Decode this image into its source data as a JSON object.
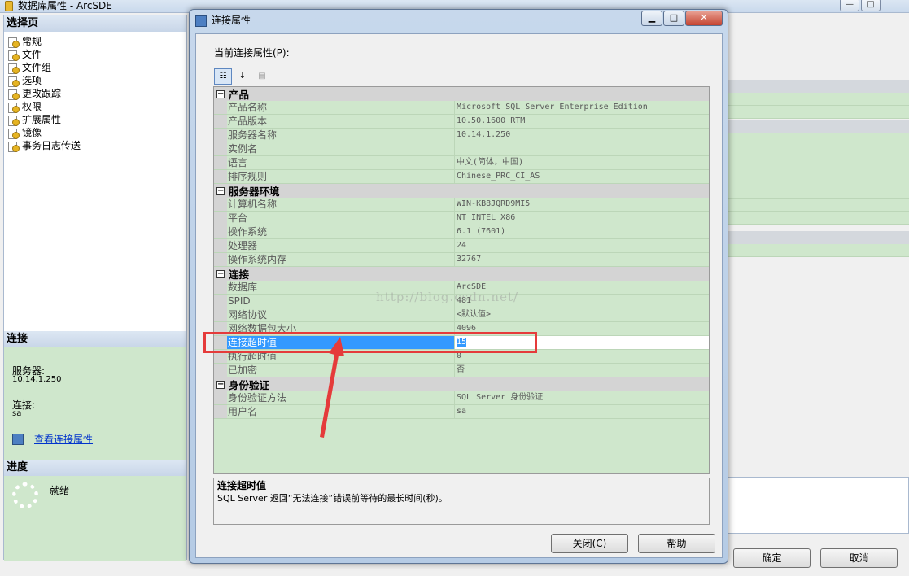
{
  "background_window": {
    "title": "数据库属性 - ArcSDE",
    "titlebar_buttons": [
      "—",
      "□"
    ],
    "select_page_header": "选择页",
    "nav_items": [
      "常规",
      "文件",
      "文件组",
      "选项",
      "更改跟踪",
      "权限",
      "扩展属性",
      "镜像",
      "事务日志传送"
    ],
    "connection_header": "连接",
    "server_label": "服务器:",
    "server_value": "10.14.1.250",
    "connection_label": "连接:",
    "connection_value": "sa",
    "view_conn_props_link": "查看连接属性",
    "progress_header": "进度",
    "progress_status": "就绪",
    "ok_button": "确定",
    "cancel_button": "取消"
  },
  "dialog": {
    "title": "连接属性",
    "current_props_label": "当前连接属性(P):",
    "categories": [
      {
        "name": "产品",
        "props": [
          {
            "name": "产品名称",
            "value": "Microsoft SQL Server Enterprise Edition"
          },
          {
            "name": "产品版本",
            "value": "10.50.1600 RTM"
          },
          {
            "name": "服务器名称",
            "value": "10.14.1.250"
          },
          {
            "name": "实例名",
            "value": ""
          },
          {
            "name": "语言",
            "value": "中文(简体，中国)"
          },
          {
            "name": "排序规则",
            "value": "Chinese_PRC_CI_AS"
          }
        ]
      },
      {
        "name": "服务器环境",
        "props": [
          {
            "name": "计算机名称",
            "value": "WIN-KB8JQRD9MI5"
          },
          {
            "name": "平台",
            "value": "NT INTEL X86"
          },
          {
            "name": "操作系统",
            "value": "6.1 (7601)"
          },
          {
            "name": "处理器",
            "value": "24"
          },
          {
            "name": "操作系统内存",
            "value": "32767"
          }
        ]
      },
      {
        "name": "连接",
        "props": [
          {
            "name": "数据库",
            "value": "ArcSDE"
          },
          {
            "name": "SPID",
            "value": "481"
          },
          {
            "name": "网络协议",
            "value": "<默认值>"
          },
          {
            "name": "网络数据包大小",
            "value": "4096"
          },
          {
            "name": "连接超时值",
            "value": "15",
            "selected": true
          },
          {
            "name": "执行超时值",
            "value": "0"
          },
          {
            "name": "已加密",
            "value": "否"
          }
        ]
      },
      {
        "name": "身份验证",
        "props": [
          {
            "name": "身份验证方法",
            "value": "SQL Server 身份验证"
          },
          {
            "name": "用户名",
            "value": "sa"
          }
        ]
      }
    ],
    "description_title": "连接超时值",
    "description_text": "SQL Server 返回“无法连接”错误前等待的最长时间(秒)。",
    "close_button": "关闭(C)",
    "help_button": "帮助"
  },
  "watermark": "http://blog.csdn.net/",
  "colors": {
    "grid_green": "#cfe7cc",
    "selection_blue": "#3399ff",
    "annotation_red": "#e53b3b"
  }
}
